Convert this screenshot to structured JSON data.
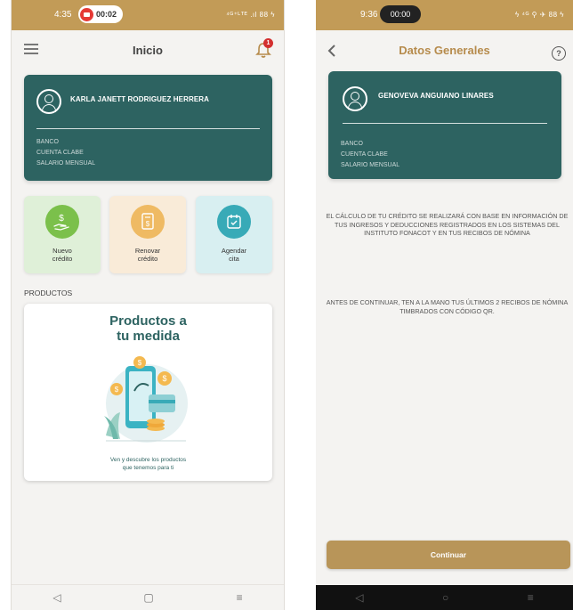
{
  "left_screen": {
    "status": {
      "time": "4:35",
      "recording": "00:02",
      "indicators": "⁴ᴳ⁺ᴸᵀᴱ .ıl 88 ϟ"
    },
    "header": {
      "title": "Inicio",
      "notification_count": "1",
      "menu_icon": "menu-icon",
      "bell_icon": "bell-icon"
    },
    "account": {
      "name": "KARLA JANETT RODRIGUEZ HERRERA",
      "fields": [
        "BANCO",
        "CUENTA CLABE",
        "SALARIO MENSUAL"
      ]
    },
    "tiles": [
      {
        "line1": "Nuevo",
        "line2": "crédito",
        "icon": "money-hand-icon",
        "bg": "#dff0d8",
        "circle": "#7bc04b"
      },
      {
        "line1": "Renovar",
        "line2": "crédito",
        "icon": "document-money-icon",
        "bg": "#f9ebd8",
        "circle": "#efba63"
      },
      {
        "line1": "Agendar",
        "line2": "cita",
        "icon": "calendar-icon",
        "bg": "#d8eff1",
        "circle": "#38aab7"
      }
    ],
    "products_label": "PRODUCTOS",
    "product_card": {
      "title_line1": "Productos a",
      "title_line2": "tu medida",
      "caption_line1": "Ven y descubre los productos",
      "caption_line2": "que tenemos para ti"
    },
    "nav": [
      "◁",
      "▢",
      "≡"
    ]
  },
  "right_screen": {
    "status": {
      "time": "9:36",
      "recording": "00:00",
      "indicators": "ϟ ⁴ᴳ ⚲ ✈ 88 ϟ"
    },
    "header": {
      "title": "Datos Generales",
      "back_icon": "back-arrow-icon",
      "help_icon": "help-icon"
    },
    "account": {
      "name": "GENOVEVA ANGUIANO LINARES",
      "fields": [
        "BANCO",
        "CUENTA CLABE",
        "SALARIO MENSUAL"
      ]
    },
    "notice1": "EL CÁLCULO DE TU CRÉDITO SE REALIZARÁ CON BASE EN INFORMACIÓN DE TUS INGRESOS Y DEDUCCIONES REGISTRADOS EN LOS SISTEMAS DEL INSTITUTO FONACOT Y EN TUS RECIBOS DE NÓMINA",
    "notice2": "ANTES DE CONTINUAR, TEN A LA MANO TUS ÚLTIMOS 2 RECIBOS DE NÓMINA TIMBRADOS CON CÓDIGO QR.",
    "continue_label": "Continuar",
    "nav": [
      "◁",
      "○",
      "≡"
    ]
  },
  "colors": {
    "teal": "#2d6361",
    "gold": "#c29b57",
    "button": "#b89559",
    "badge": "#d32f2f"
  }
}
